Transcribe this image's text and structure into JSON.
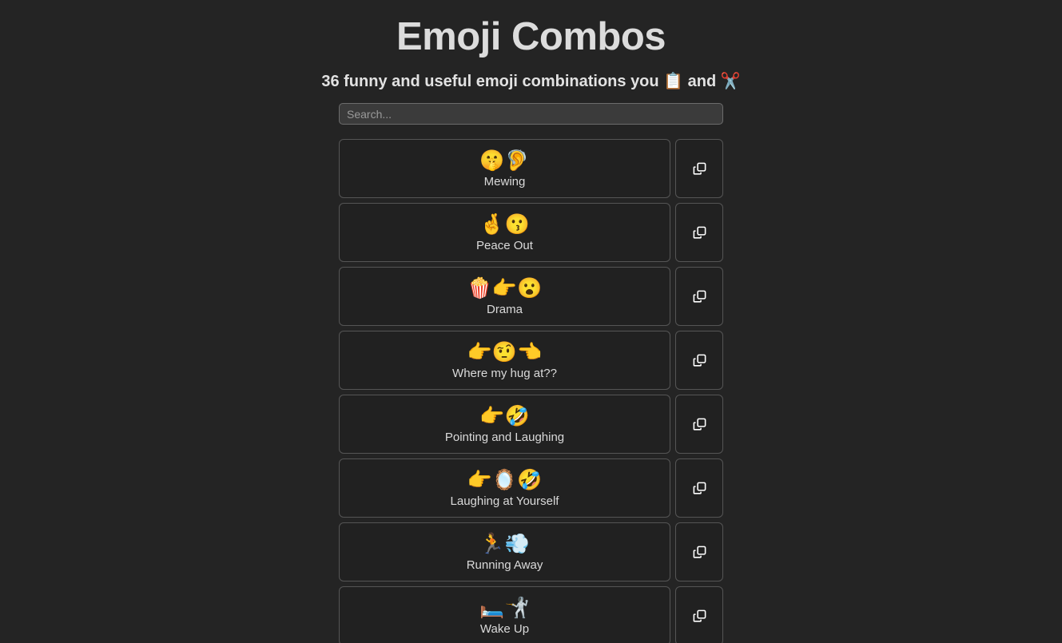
{
  "header": {
    "title": "Emoji Combos",
    "subtitle": "36 funny and useful emoji combinations you 📋 and ✂️"
  },
  "search": {
    "placeholder": "Search...",
    "value": ""
  },
  "combos": [
    {
      "emoji": "🤫🦻",
      "label": "Mewing",
      "copy_icon": "copy-icon"
    },
    {
      "emoji": "🤞😗",
      "label": "Peace Out",
      "copy_icon": "copy-icon"
    },
    {
      "emoji": "🍿👉😮",
      "label": "Drama",
      "copy_icon": "copy-icon"
    },
    {
      "emoji": "👉🤨👈",
      "label": "Where my hug at??",
      "copy_icon": "copy-icon"
    },
    {
      "emoji": "👉🤣",
      "label": "Pointing and Laughing",
      "copy_icon": "copy-icon"
    },
    {
      "emoji": "👉🪞🤣",
      "label": "Laughing at Yourself",
      "copy_icon": "copy-icon"
    },
    {
      "emoji": "🏃💨",
      "label": "Running Away",
      "copy_icon": "copy-icon"
    },
    {
      "emoji": "🛏️🤺",
      "label": "Wake Up",
      "copy_icon": "copy-icon"
    }
  ],
  "colors": {
    "background": "#242424",
    "card_background": "#212121",
    "card_border": "#555555",
    "input_background": "#3b3b3b",
    "input_border": "#6c6c6c",
    "title_text": "#dcdcdc",
    "label_text": "#dadada",
    "icon": "#ffffff"
  }
}
